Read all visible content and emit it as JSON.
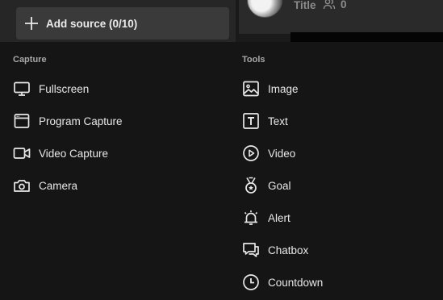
{
  "toolbar": {
    "add_source_label": "Add source (0/10)",
    "title": "Title",
    "viewer_count": "0"
  },
  "capture": {
    "heading": "Capture",
    "items": [
      {
        "label": "Fullscreen",
        "icon": "monitor-icon"
      },
      {
        "label": "Program Capture",
        "icon": "window-icon"
      },
      {
        "label": "Video Capture",
        "icon": "video-camera-icon"
      },
      {
        "label": "Camera",
        "icon": "camera-icon"
      }
    ]
  },
  "tools": {
    "heading": "Tools",
    "items": [
      {
        "label": "Image",
        "icon": "image-icon"
      },
      {
        "label": "Text",
        "icon": "text-icon"
      },
      {
        "label": "Video",
        "icon": "play-circle-icon"
      },
      {
        "label": "Goal",
        "icon": "medal-icon"
      },
      {
        "label": "Alert",
        "icon": "alarm-bell-icon"
      },
      {
        "label": "Chatbox",
        "icon": "chat-icon"
      },
      {
        "label": "Countdown",
        "icon": "clock-icon"
      }
    ]
  }
}
